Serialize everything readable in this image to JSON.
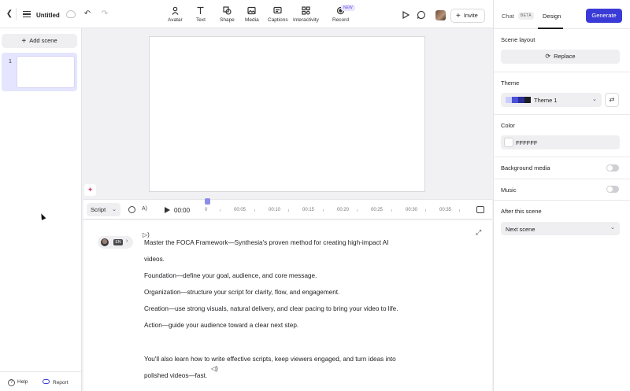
{
  "header": {
    "title": "Untitled",
    "tools": [
      {
        "label": "Avatar",
        "icon": "avatar-icon"
      },
      {
        "label": "Text",
        "icon": "text-icon"
      },
      {
        "label": "Shape",
        "icon": "shape-icon"
      },
      {
        "label": "Media",
        "icon": "media-icon"
      },
      {
        "label": "Captions",
        "icon": "captions-icon"
      },
      {
        "label": "Interactivity",
        "icon": "interactivity-icon"
      },
      {
        "label": "Record",
        "icon": "record-icon"
      }
    ],
    "new_badge": "NEW",
    "invite_label": "Invite"
  },
  "right_panel": {
    "tab_chat": "Chat",
    "tab_chat_badge": "BETA",
    "tab_design": "Design",
    "generate_label": "Generate",
    "scene_layout_label": "Scene layout",
    "replace_label": "Replace",
    "theme_label": "Theme",
    "theme_value": "Theme 1",
    "theme_swatches": [
      "#c8ccff",
      "#4b4fd8",
      "#2a2d9a",
      "#1d1d24"
    ],
    "color_label": "Color",
    "color_value": "FFFFFF",
    "background_media_label": "Background media",
    "background_media_on": false,
    "music_label": "Music",
    "music_on": false,
    "after_scene_label": "After this scene",
    "after_scene_value": "Next scene"
  },
  "left_panel": {
    "add_scene_label": "Add scene",
    "scenes": [
      {
        "number": "1"
      }
    ],
    "help_label": "Help",
    "report_label": "Report"
  },
  "timeline": {
    "mode": "Script",
    "current_time": "00:00",
    "ticks": [
      "0",
      "00:05",
      "00:10",
      "00:15",
      "00:20",
      "00:25",
      "00:30",
      "00:35"
    ]
  },
  "script": {
    "language": "EN",
    "lines": [
      "Master the FOCA Framework—Synthesia's proven method for creating high-impact AI",
      "videos.",
      "Foundation—define your goal, audience, and core message.",
      "Organization—structure your script for clarity, flow, and engagement.",
      "Creation—use strong visuals, natural delivery, and clear pacing to bring your video to life.",
      "Action—guide your audience toward a clear next step.",
      "You'll also learn how to write effective scripts, keep viewers engaged, and turn ideas into",
      "polished videos—fast."
    ]
  },
  "colors": {
    "accent": "#3a3bd6",
    "scene_selected_bg": "#e4e6ff"
  }
}
